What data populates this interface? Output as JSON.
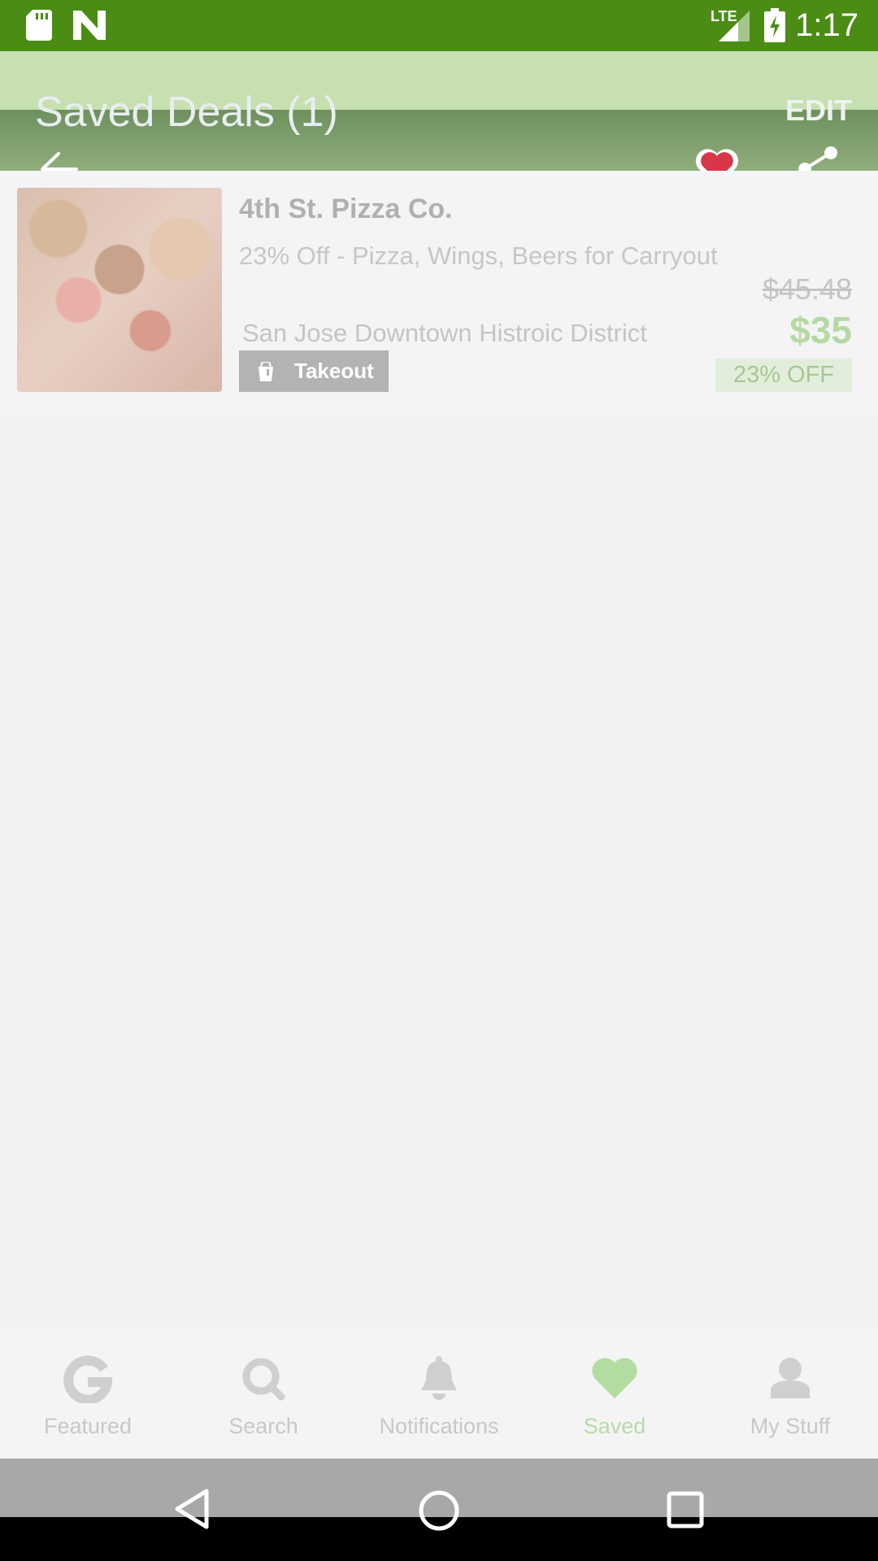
{
  "status_bar": {
    "time": "1:17",
    "network": "LTE",
    "icons": [
      "sd-card-icon",
      "n-notification-icon",
      "lte-signal-icon",
      "battery-charging-icon"
    ]
  },
  "app_bar": {
    "title": "Saved Deals (1)",
    "edit_label": "EDIT"
  },
  "deal": {
    "name": "4th St. Pizza Co.",
    "description": "23% Off - Pizza, Wings, Beers for Carryout",
    "location": "San Jose Downtown Histroic District",
    "tag_label": "Takeout",
    "original_price": "$45.48",
    "price": "$35",
    "discount": "23% OFF"
  },
  "bottom_nav": {
    "items": [
      {
        "label": "Featured",
        "icon": "featured-g-icon",
        "active": false
      },
      {
        "label": "Search",
        "icon": "search-icon",
        "active": false
      },
      {
        "label": "Notifications",
        "icon": "bell-icon",
        "active": false
      },
      {
        "label": "Saved",
        "icon": "heart-icon",
        "active": true
      },
      {
        "label": "My Stuff",
        "icon": "person-icon",
        "active": false
      }
    ]
  },
  "colors": {
    "status_bar": "#4a8c14",
    "accent_green": "#b6d9a4",
    "heart_red": "#d9364a"
  }
}
